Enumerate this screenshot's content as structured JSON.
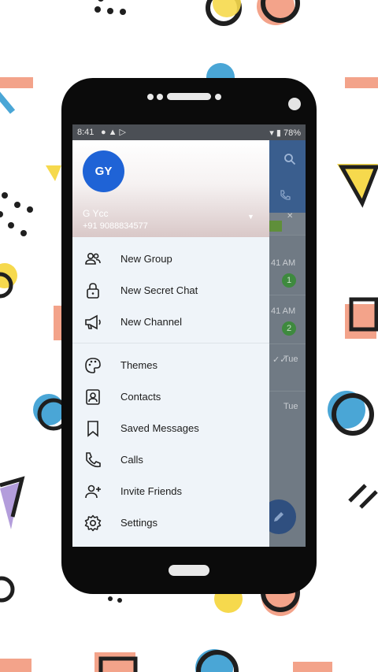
{
  "status_bar": {
    "time": "8:41",
    "left_icons": [
      "chat-bubble-icon",
      "warning-icon",
      "play-store-icon"
    ],
    "battery": "78%"
  },
  "drawer": {
    "avatar_initials": "GY",
    "user_name": "G Ycc",
    "user_phone": "+91 9088834577",
    "menu": [
      {
        "label": "New Group",
        "icon": "group-icon"
      },
      {
        "label": "New Secret Chat",
        "icon": "lock-icon"
      },
      {
        "label": "New Channel",
        "icon": "megaphone-icon"
      },
      {
        "label": "Themes",
        "icon": "palette-icon"
      },
      {
        "label": "Contacts",
        "icon": "contact-icon"
      },
      {
        "label": "Saved Messages",
        "icon": "bookmark-icon"
      },
      {
        "label": "Calls",
        "icon": "phone-icon"
      },
      {
        "label": "Invite Friends",
        "icon": "add-person-icon"
      },
      {
        "label": "Settings",
        "icon": "gear-icon"
      }
    ]
  },
  "background_chats": {
    "times": [
      "41 AM",
      "41 AM",
      "Tue",
      "Tue"
    ],
    "badges": [
      "1",
      "2"
    ]
  },
  "colors": {
    "avatar": "#1f63d6",
    "drawer_bg": "#eff4f9",
    "status_bar": "#4b4f55",
    "app_header": "#3a5e8e"
  }
}
